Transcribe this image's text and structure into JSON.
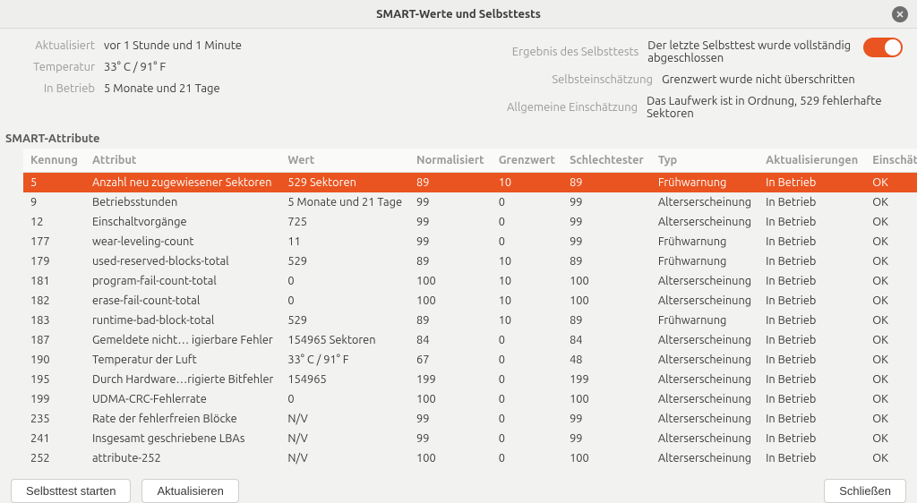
{
  "title": "SMART-Werte und Selbsttests",
  "info": {
    "left": [
      {
        "label": "Aktualisiert",
        "value": "vor 1 Stunde und 1 Minute"
      },
      {
        "label": "Temperatur",
        "value": "33° C / 91° F"
      },
      {
        "label": "In Betrieb",
        "value": "5 Monate und 21 Tage"
      }
    ],
    "right": [
      {
        "label": "Ergebnis des Selbsttests",
        "value": "Der letzte Selbsttest wurde vollständig abgeschlossen"
      },
      {
        "label": "Selbsteinschätzung",
        "value": "Grenzwert wurde nicht überschritten"
      },
      {
        "label": "Allgemeine Einschätzung",
        "value": "Das Laufwerk ist in Ordnung, 529 fehlerhafte Sektoren"
      }
    ]
  },
  "toggle_on": true,
  "section": "SMART-Attribute",
  "columns": [
    "Kennung",
    "Attribut",
    "Wert",
    "Normalisiert",
    "Grenzwert",
    "Schlechtester",
    "Typ",
    "Aktualisierungen",
    "Einschätzung"
  ],
  "rows": [
    {
      "sel": true,
      "c": [
        "5",
        "Anzahl neu zugewiesener Sektoren",
        "529 Sektoren",
        "89",
        "10",
        "89",
        "Frühwarnung",
        "In Betrieb",
        "OK"
      ]
    },
    {
      "sel": false,
      "c": [
        "9",
        "Betriebsstunden",
        "5 Monate und 21 Tage",
        "99",
        "0",
        "99",
        "Alterserscheinung",
        "In Betrieb",
        "OK"
      ]
    },
    {
      "sel": false,
      "c": [
        "12",
        "Einschaltvorgänge",
        "725",
        "99",
        "0",
        "99",
        "Alterserscheinung",
        "In Betrieb",
        "OK"
      ]
    },
    {
      "sel": false,
      "c": [
        "177",
        "wear-leveling-count",
        "11",
        "99",
        "0",
        "99",
        "Frühwarnung",
        "In Betrieb",
        "OK"
      ]
    },
    {
      "sel": false,
      "c": [
        "179",
        "used-reserved-blocks-total",
        "529",
        "89",
        "10",
        "89",
        "Frühwarnung",
        "In Betrieb",
        "OK"
      ]
    },
    {
      "sel": false,
      "c": [
        "181",
        "program-fail-count-total",
        "0",
        "100",
        "10",
        "100",
        "Alterserscheinung",
        "In Betrieb",
        "OK"
      ]
    },
    {
      "sel": false,
      "c": [
        "182",
        "erase-fail-count-total",
        "0",
        "100",
        "10",
        "100",
        "Alterserscheinung",
        "In Betrieb",
        "OK"
      ]
    },
    {
      "sel": false,
      "c": [
        "183",
        "runtime-bad-block-total",
        "529",
        "89",
        "10",
        "89",
        "Frühwarnung",
        "In Betrieb",
        "OK"
      ]
    },
    {
      "sel": false,
      "c": [
        "187",
        "Gemeldete nicht… igierbare Fehler",
        "154965 Sektoren",
        "84",
        "0",
        "84",
        "Alterserscheinung",
        "In Betrieb",
        "OK"
      ]
    },
    {
      "sel": false,
      "c": [
        "190",
        "Temperatur der Luft",
        "33° C / 91° F",
        "67",
        "0",
        "48",
        "Alterserscheinung",
        "In Betrieb",
        "OK"
      ]
    },
    {
      "sel": false,
      "c": [
        "195",
        "Durch Hardware…rigierte Bitfehler",
        "154965",
        "199",
        "0",
        "199",
        "Alterserscheinung",
        "In Betrieb",
        "OK"
      ]
    },
    {
      "sel": false,
      "c": [
        "199",
        "UDMA-CRC-Fehlerrate",
        "0",
        "100",
        "0",
        "100",
        "Alterserscheinung",
        "In Betrieb",
        "OK"
      ]
    },
    {
      "sel": false,
      "c": [
        "235",
        "Rate der fehlerfreien Blöcke",
        "N/V",
        "99",
        "0",
        "99",
        "Alterserscheinung",
        "In Betrieb",
        "OK"
      ]
    },
    {
      "sel": false,
      "c": [
        "241",
        "Insgesamt geschriebene LBAs",
        "N/V",
        "99",
        "0",
        "99",
        "Alterserscheinung",
        "In Betrieb",
        "OK"
      ]
    },
    {
      "sel": false,
      "c": [
        "252",
        "attribute-252",
        "N/V",
        "100",
        "0",
        "100",
        "Alterserscheinung",
        "In Betrieb",
        "OK"
      ]
    }
  ],
  "buttons": {
    "selftest": "Selbsttest starten",
    "refresh": "Aktualisieren",
    "close": "Schließen"
  }
}
